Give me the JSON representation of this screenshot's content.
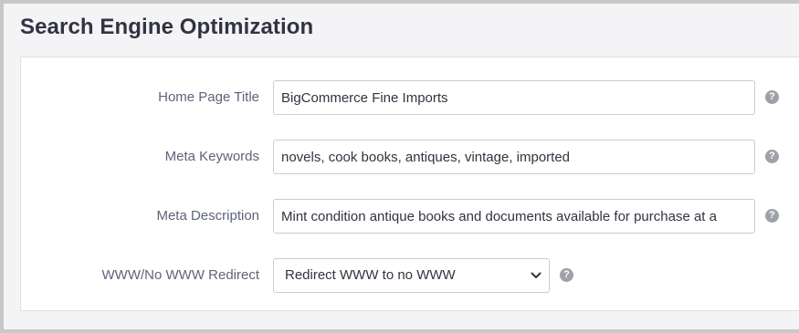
{
  "section": {
    "title": "Search Engine Optimization"
  },
  "fields": {
    "home_page_title": {
      "label": "Home Page Title",
      "value": "BigCommerce Fine Imports"
    },
    "meta_keywords": {
      "label": "Meta Keywords",
      "value": "novels, cook books, antiques, vintage, imported"
    },
    "meta_description": {
      "label": "Meta Description",
      "value": "Mint condition antique books and documents available for purchase at a"
    },
    "www_redirect": {
      "label": "WWW/No WWW Redirect",
      "selected": "Redirect WWW to no WWW"
    }
  },
  "help_icon_glyph": "?",
  "colors": {
    "title_text": "#313440",
    "label_text": "#5e637a",
    "input_border": "#c9ccd5",
    "help_icon_bg": "#9ea1a8",
    "page_bg": "#f4f4f6"
  }
}
